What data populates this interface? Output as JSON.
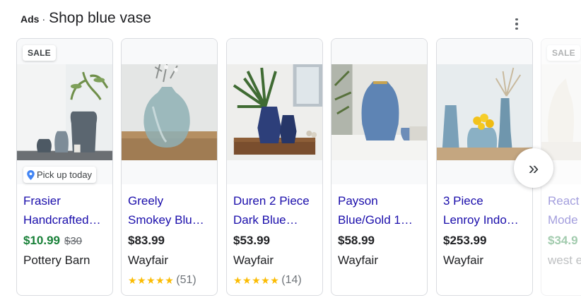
{
  "header": {
    "ads_label": "Ads",
    "separator": "·",
    "title": "Shop blue vase"
  },
  "more_icon": "more-vert-icon",
  "cards": [
    {
      "sale": "SALE",
      "pickup": "Pick up today",
      "name_line1": "Frasier",
      "name_line2": "Handcrafted…",
      "price": "$10.99",
      "old_price": "$30",
      "merchant": "Pottery Barn",
      "stars": "",
      "review_count": ""
    },
    {
      "sale": "",
      "pickup": "",
      "name_line1": "Greely",
      "name_line2": "Smokey Blu…",
      "price": "$83.99",
      "old_price": "",
      "merchant": "Wayfair",
      "stars": "★★★★★",
      "review_count": "(51)"
    },
    {
      "sale": "",
      "pickup": "",
      "name_line1": "Duren 2 Piece",
      "name_line2": "Dark Blue…",
      "price": "$53.99",
      "old_price": "",
      "merchant": "Wayfair",
      "stars": "★★★★★",
      "review_count": "(14)"
    },
    {
      "sale": "",
      "pickup": "",
      "name_line1": "Payson",
      "name_line2": "Blue/Gold 1…",
      "price": "$58.99",
      "old_price": "",
      "merchant": "Wayfair",
      "stars": "",
      "review_count": ""
    },
    {
      "sale": "",
      "pickup": "",
      "name_line1": "3 Piece",
      "name_line2": "Lenroy Indo…",
      "price": "$253.99",
      "old_price": "",
      "merchant": "Wayfair",
      "stars": "",
      "review_count": ""
    },
    {
      "sale": "SALE",
      "pickup": "",
      "name_line1": "React",
      "name_line2": "Mode",
      "price": "$34.9",
      "old_price": "",
      "merchant": "west e",
      "stars": "",
      "review_count": ""
    }
  ],
  "next_icon": "double-chevron-right-icon",
  "next_glyph": "»",
  "colors": {
    "link": "#1a0dab",
    "sale_price": "#188038",
    "star": "#fbbc04",
    "pin": "#4285f4"
  }
}
